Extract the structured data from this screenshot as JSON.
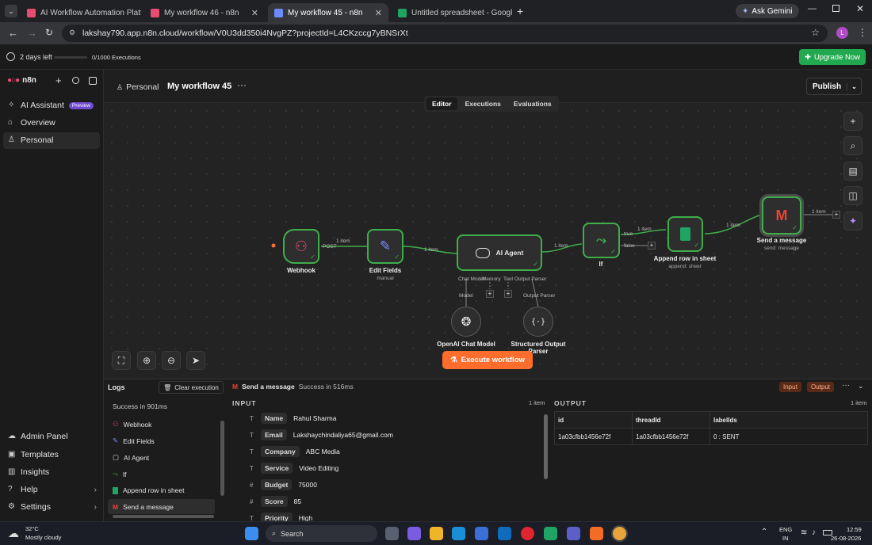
{
  "browser": {
    "tabs": [
      {
        "title": "AI Workflow Automation Platfo",
        "active": false
      },
      {
        "title": "My workflow 46 - n8n",
        "active": false
      },
      {
        "title": "My workflow 45 - n8n",
        "active": true
      },
      {
        "title": "Untitled spreadsheet - Google",
        "active": false
      }
    ],
    "ask_gemini": "Ask Gemini",
    "url": "lakshay790.app.n8n.cloud/workflow/V0U3dd350i4NvgPZ?projectId=L4CKzccg7yBNSrXt",
    "profile_initial": "L"
  },
  "trial": {
    "days_left": "2 days left",
    "executions": "0/1000 Executions",
    "upgrade_label": "Upgrade Now"
  },
  "sidebar": {
    "brand": "n8n",
    "items": [
      {
        "label": "AI Assistant",
        "badge": "Preview",
        "icon": "sparkle-icon"
      },
      {
        "label": "Overview",
        "icon": "home-icon"
      },
      {
        "label": "Personal",
        "icon": "user-icon"
      }
    ],
    "bottom_items": [
      {
        "label": "Admin Panel",
        "icon": "cloud-icon"
      },
      {
        "label": "Templates",
        "icon": "box-icon"
      },
      {
        "label": "Insights",
        "icon": "chart-icon"
      },
      {
        "label": "Help",
        "icon": "help-icon"
      },
      {
        "label": "Settings",
        "icon": "gear-icon"
      }
    ]
  },
  "header": {
    "project": "Personal",
    "workflow_name": "My workflow 45",
    "publish_label": "Publish",
    "tabs": [
      "Editor",
      "Executions",
      "Evaluations"
    ],
    "active_tab": "Editor"
  },
  "canvas": {
    "nodes": {
      "webhook": {
        "label": "Webhook"
      },
      "edit_fields": {
        "label": "Edit Fields",
        "sub": "manual"
      },
      "ai_agent": {
        "label": "AI Agent"
      },
      "if": {
        "label": "If"
      },
      "append_row": {
        "label": "Append row in sheet",
        "sub": "append: sheet"
      },
      "send_message": {
        "label": "Send a message",
        "sub": "send: message"
      },
      "openai": {
        "label": "OpenAI Chat Model"
      },
      "parser": {
        "label": "Structured Output Parser"
      }
    },
    "edge_labels": {
      "post": "POST",
      "item1": "1 item",
      "item2": "1 item",
      "item3": "1 item",
      "item4": "1 item",
      "item5": "1 item",
      "item6": "1 item",
      "true": "true",
      "false": "false"
    },
    "agent_ports": [
      "Chat Model",
      "Memory",
      "Tool",
      "Output Parser"
    ],
    "model_label": "Model",
    "output_parser_label": "Output Parser",
    "execute_label": "Execute workflow"
  },
  "logs": {
    "title": "Logs",
    "clear_label": "Clear execution",
    "success": "Success in 901ms",
    "items": [
      {
        "label": "Webhook"
      },
      {
        "label": "Edit Fields"
      },
      {
        "label": "AI Agent"
      },
      {
        "label": "If"
      },
      {
        "label": "Append row in sheet"
      },
      {
        "label": "Send a message"
      }
    ],
    "selected_node": "Send a message",
    "selected_status": "Success in 516ms",
    "input_btn": "Input",
    "output_btn": "Output",
    "input_title": "INPUT",
    "input_count": "1 item",
    "input_rows": [
      {
        "type": "T",
        "key": "Name",
        "value": "Rahul Sharma"
      },
      {
        "type": "T",
        "key": "Email",
        "value": "Lakshaychindaliya65@gmail.com"
      },
      {
        "type": "T",
        "key": "Company",
        "value": "ABC Media"
      },
      {
        "type": "T",
        "key": "Service",
        "value": "Video Editing"
      },
      {
        "type": "#",
        "key": "Budget",
        "value": "75000"
      },
      {
        "type": "#",
        "key": "Score",
        "value": "85"
      },
      {
        "type": "T",
        "key": "Priority",
        "value": "High"
      }
    ],
    "output_title": "OUTPUT",
    "output_count": "1 item",
    "output_headers": [
      "id",
      "threadId",
      "labelIds"
    ],
    "output_row": [
      "1a03cfbb1456e72f",
      "1a03cfbb1456e72f",
      "0 : SENT"
    ]
  },
  "taskbar": {
    "temp": "32°C",
    "weather": "Mostly cloudy",
    "search": "Search",
    "lang": "ENG",
    "region": "IN",
    "time": "12:59",
    "date": "26-08-2026"
  },
  "colors": {
    "accent": "#ff6d2d",
    "success": "#3fae4a",
    "upgrade": "#22a94f"
  }
}
